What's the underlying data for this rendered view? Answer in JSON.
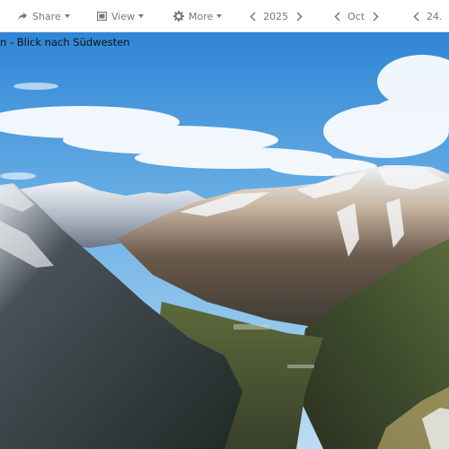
{
  "toolbar": {
    "share": {
      "label": "Share",
      "icon": "share-icon"
    },
    "view": {
      "label": "View",
      "icon": "view-icon"
    },
    "more": {
      "label": "More",
      "icon": "gear-icon"
    },
    "year": {
      "label": "2025"
    },
    "month": {
      "label": "Oct"
    },
    "day": {
      "label": "24."
    }
  },
  "image": {
    "caption": "n - Blick nach Südwesten"
  },
  "colors": {
    "toolbar_text": "#777777",
    "sky_top": "#2f86d6",
    "sky_bottom": "#bcdcf2"
  }
}
